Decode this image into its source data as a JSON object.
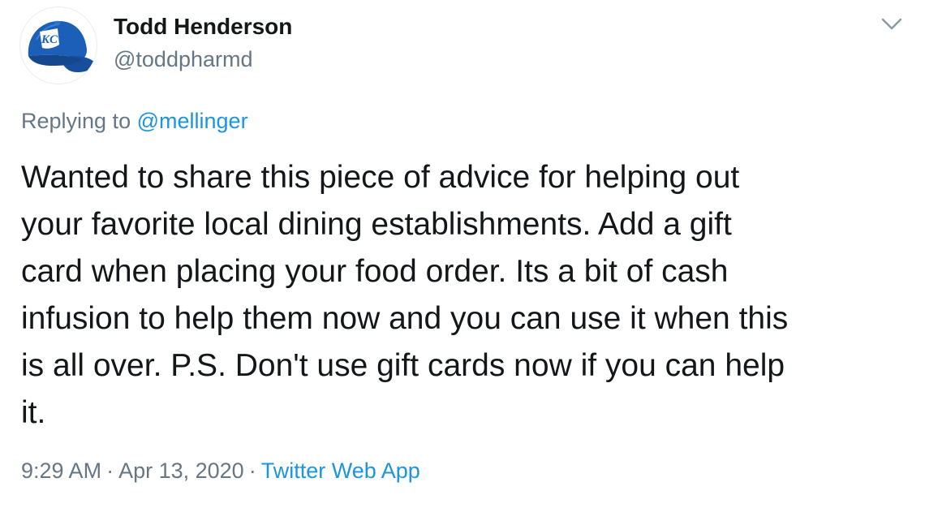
{
  "author": {
    "display_name": "Todd Henderson",
    "handle": "@toddpharmd",
    "avatar": {
      "icon": "kc-cap-avatar-icon",
      "logo_text": "KC",
      "cap_color": "#1c5fb8"
    }
  },
  "menu": {
    "icon": "chevron-down-icon"
  },
  "reply": {
    "prefix": "Replying to",
    "target": "@mellinger"
  },
  "tweet": {
    "lines": [
      "Wanted to share this piece of advice for helping out",
      "your favorite local dining establishments. Add a gift",
      "card when placing your food order. Its a bit of cash",
      "infusion to help them now and you can use it when this",
      "is all over. P.S. Don't use gift cards now if you can help",
      "it."
    ]
  },
  "meta": {
    "time": "9:29 AM",
    "separator": "·",
    "date": "Apr 13, 2020",
    "source": "Twitter Web App"
  },
  "colors": {
    "text": "#14171a",
    "secondary": "#657786",
    "link": "#1b95e0"
  }
}
